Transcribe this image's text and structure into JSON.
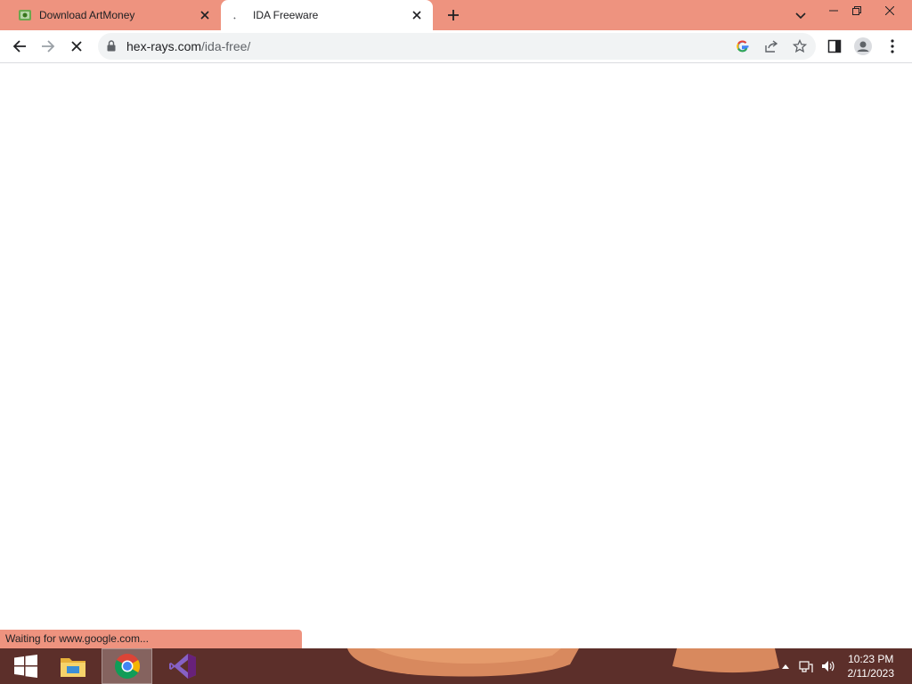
{
  "browser": {
    "tabs": [
      {
        "title": "Download ArtMoney",
        "favicon": "artmoney-favicon",
        "active": false
      },
      {
        "title": "IDA Freeware",
        "favicon": "loading-spinner",
        "active": true
      }
    ],
    "url": {
      "host": "hex-rays.com",
      "path": "/ida-free/"
    },
    "status": "Waiting for www.google.com..."
  },
  "taskbar": {
    "apps": [
      "windows-start",
      "file-explorer",
      "chrome",
      "visual-studio"
    ],
    "clock": {
      "time": "10:23 PM",
      "date": "2/11/2023"
    }
  },
  "colors": {
    "accent": "#ee937f",
    "taskbar": "#5c2f2a"
  }
}
